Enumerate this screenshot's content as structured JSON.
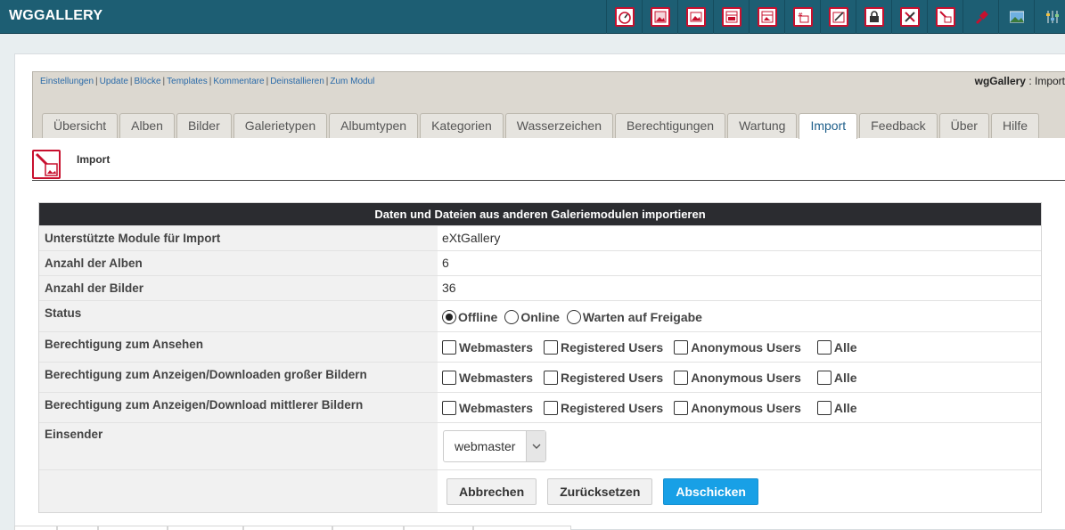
{
  "app": {
    "title": "WGGALLERY"
  },
  "toolbar": {
    "icons": [
      "dashboard-icon",
      "album-icon",
      "image-icon",
      "gallerytypes-icon",
      "albumtypes-icon",
      "categories-icon",
      "watermark-icon",
      "permissions-icon",
      "maintenance-icon",
      "import-icon",
      "feedback-icon",
      "about-icon",
      "settings-icon"
    ]
  },
  "module": {
    "links": [
      "Einstellungen",
      "Update",
      "Blöcke",
      "Templates",
      "Kommentare",
      "Deinstallieren",
      "Zum Modul"
    ],
    "title_bold": "wgGallery",
    "title_rest": " : Import"
  },
  "tabs": [
    "Übersicht",
    "Alben",
    "Bilder",
    "Galerietypen",
    "Albumtypen",
    "Kategorien",
    "Wasserzeichen",
    "Berechtigungen",
    "Wartung",
    "Import",
    "Feedback",
    "Über",
    "Hilfe"
  ],
  "active_tab": "Import",
  "page": {
    "title": "Import"
  },
  "form": {
    "header": "Daten und Dateien aus anderen Galeriemodulen importieren",
    "rows": {
      "modules": {
        "label": "Unterstützte Module für Import",
        "value": "eXtGallery"
      },
      "albums": {
        "label": "Anzahl der Alben",
        "value": "6"
      },
      "images": {
        "label": "Anzahl der Bilder",
        "value": "36"
      },
      "status": {
        "label": "Status",
        "options": [
          "Offline",
          "Online",
          "Warten auf Freigabe"
        ],
        "selected": "Offline"
      },
      "perm_view": {
        "label": "Berechtigung zum Ansehen"
      },
      "perm_large": {
        "label": "Berechtigung zum Anzeigen/Downloaden großer Bildern"
      },
      "perm_medium": {
        "label": "Berechtigung zum Anzeigen/Download mittlerer Bildern"
      },
      "submitter": {
        "label": "Einsender",
        "value": "webmaster"
      }
    },
    "groups": [
      "Webmasters",
      "Registered Users",
      "Anonymous Users",
      "Alle"
    ],
    "buttons": {
      "cancel": "Abbrechen",
      "reset": "Zurücksetzen",
      "submit": "Abschicken"
    }
  },
  "colors": {
    "topbar": "#1d5e73",
    "accent_red": "#c8102e",
    "submit_blue": "#18a0e6",
    "table_head": "#2b2c30"
  }
}
